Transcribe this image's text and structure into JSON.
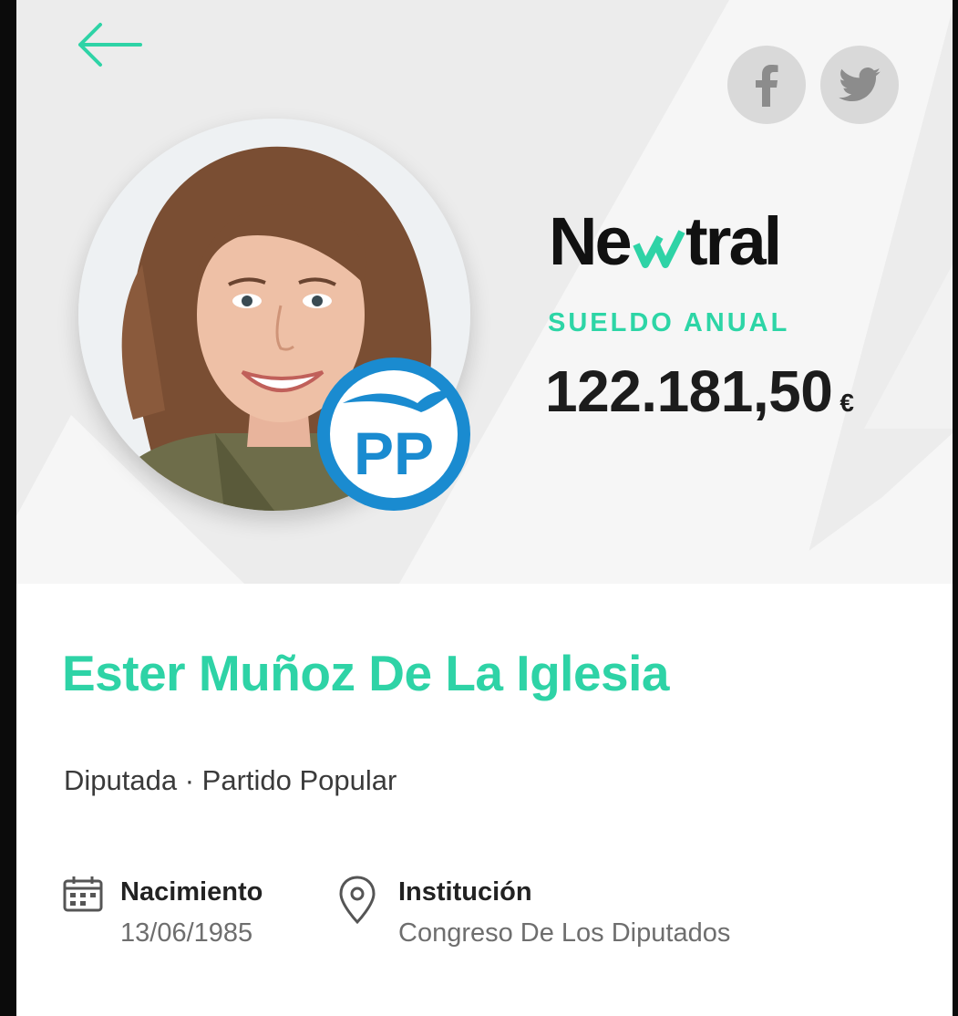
{
  "header": {
    "back_icon": "arrow-left-icon",
    "social": [
      {
        "network": "facebook",
        "icon": "facebook-icon"
      },
      {
        "network": "twitter",
        "icon": "twitter-icon"
      }
    ]
  },
  "profile": {
    "photo": "portrait-photo",
    "party_logo_text": "PP"
  },
  "brand": {
    "name_start": "Ne",
    "name_end": "tral"
  },
  "salary": {
    "label": "SUELDO ANUAL",
    "amount": "122.181,50",
    "currency": "€"
  },
  "person": {
    "name": "Ester Muñoz De La Iglesia",
    "role": "Diputada",
    "separator": "·",
    "party": "Partido Popular"
  },
  "info": {
    "birth": {
      "label": "Nacimiento",
      "value": "13/06/1985",
      "icon": "calendar-icon"
    },
    "institution": {
      "label": "Institución",
      "value": "Congreso De Los Diputados",
      "icon": "location-pin-icon"
    }
  },
  "colors": {
    "accent": "#2ed3a6",
    "hero_bg": "#ececec",
    "party_blue": "#1a8bd0",
    "text_dark": "#1c1c1c",
    "text_muted": "#6e6e6e"
  }
}
